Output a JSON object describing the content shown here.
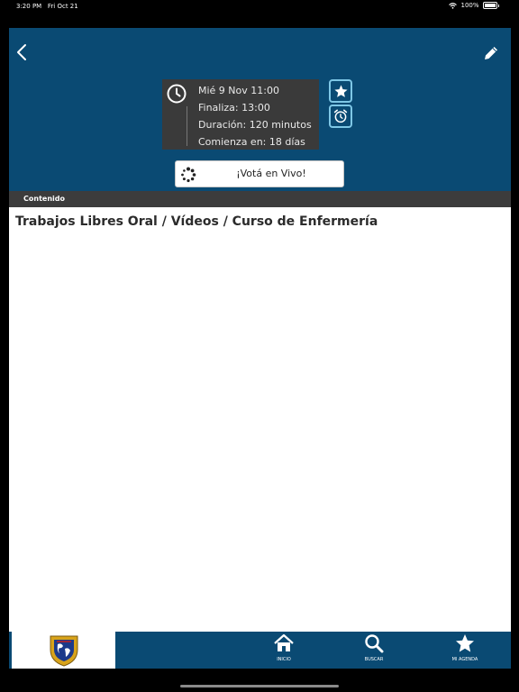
{
  "status_bar": {
    "time": "3:20 PM",
    "date": "Fri Oct 21",
    "battery": "100%"
  },
  "header": {
    "back_icon": "chevron-left-icon",
    "edit_icon": "pencil-icon",
    "schedule": {
      "date_time": "Mié 9  Nov  11:00",
      "ends": "Finaliza: 13:00",
      "duration": "Duración: 120 minutos",
      "starts_in": "Comienza en: 18 días"
    },
    "vote_button": "¡Votá en Vivo!"
  },
  "section": {
    "label": "Contenido"
  },
  "content": {
    "title": "Trabajos Libres Oral / Vídeos / Curso de Enfermería"
  },
  "tab_bar": {
    "tabs": [
      {
        "label": "INICIO",
        "icon": "home-icon"
      },
      {
        "label": "BUSCAR",
        "icon": "search-icon"
      },
      {
        "label": "MI AGENDA",
        "icon": "star-icon"
      }
    ]
  },
  "colors": {
    "header": "#0a4a73",
    "info_box": "#3a3a3a",
    "accent": "#7ec7e6",
    "section_bar": "#3c3c3c"
  }
}
